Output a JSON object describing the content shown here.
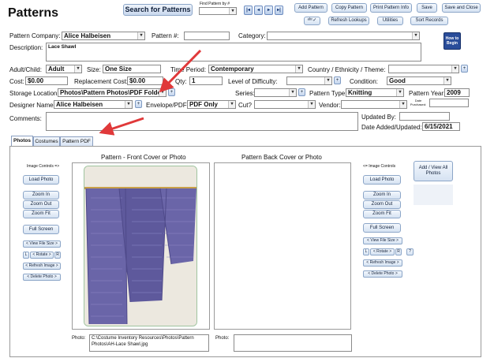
{
  "window": {
    "title": "Patterns"
  },
  "toolbar": {
    "search_label": "Search for Patterns",
    "find_label": "Find Pattern by #",
    "add_label": "Add Pattern",
    "copy_label": "Copy Pattern",
    "print_label": "Print Pattern Info",
    "save_label": "Save",
    "save_close_label": "Save and Close",
    "refresh_lookups_label": "Refresh Lookups",
    "utilities_label": "Utilities",
    "sort_records_label": "Sort Records",
    "howto_label": "How to Begin"
  },
  "form": {
    "pattern_company_label": "Pattern Company:",
    "pattern_company_value": "Alice Halbeisen",
    "pattern_num_label": "Pattern #:",
    "pattern_num_value": "",
    "category_label": "Category:",
    "category_value": "",
    "description_label": "Description:",
    "description_value": "Lace Shawl",
    "adult_child_label": "Adult/Child:",
    "adult_child_value": "Adult",
    "size_label": "Size:",
    "size_value": "One Size",
    "time_period_label": "Time Period:",
    "time_period_value": "Contemporary",
    "country_label": "Country / Ethnicity / Theme:",
    "country_value": "",
    "cost_label": "Cost:",
    "cost_value": "$0.00",
    "replacement_cost_label": "Replacement Cost:",
    "replacement_cost_value": "$0.00",
    "qty_label": "Qty:",
    "qty_value": "1",
    "difficulty_label": "Level of Difficulty:",
    "difficulty_value": "",
    "condition_label": "Condition:",
    "condition_value": "Good",
    "storage_label": "Storage Location:",
    "storage_value": "Photos\\Pattern Photos\\PDF Folder",
    "series_label": "Series:",
    "series_value": "",
    "pattern_type_label": "Pattern Type:",
    "pattern_type_value": "Knitting",
    "pattern_year_label": "Pattern Year:",
    "pattern_year_value": "2009",
    "designer_label": "Designer Name:",
    "designer_value": "Alice Halbeisen",
    "envelope_label": "Envelope/PDF:",
    "envelope_value": "PDF Only",
    "cut_label": "Cut?",
    "cut_value": "",
    "vendor_label": "Vendor:",
    "vendor_value": "",
    "date_purchased_label": "Date Purchased:",
    "date_purchased_value": "",
    "comments_label": "Comments:",
    "comments_value": "",
    "updated_by_label": "Updated By:",
    "updated_by_value": "",
    "date_added_label": "Date Added/Updated:",
    "date_added_value": "6/15/2021"
  },
  "tabs": [
    {
      "label": "Photos"
    },
    {
      "label": "Costumes"
    },
    {
      "label": "Pattern PDF"
    }
  ],
  "photos": {
    "front_title": "Pattern - Front Cover or Photo",
    "back_title": "Pattern Back Cover or Photo",
    "left_controls_label": "Image Controls =>",
    "right_controls_label": "<= Image Controls",
    "load_photo": "Load Photo",
    "zoom_in": "Zoom In",
    "zoom_out": "Zoom Out",
    "zoom_fit": "Zoom Fit",
    "full_screen": "Full Screen",
    "view_file_size": "< View File Size >",
    "rotate_l": "L",
    "rotate": "< Rotate >",
    "rotate_r": "R",
    "refresh_image": "< Refresh Image >",
    "delete_photo": "< Delete Photo >",
    "help": "?",
    "add_view_all": "Add / View All Photos",
    "photo_label": "Photo:",
    "front_photo_path": "C:\\Costume Inventory Resources\\Photos\\Pattern Photos\\AH-Lace Shawl.jpg",
    "back_photo_path": ""
  },
  "colors": {
    "shawl": "#6a65a8",
    "shawl_dark": "#4f4a8a",
    "arrow": "#e0393a",
    "book": "#2a4d9a"
  }
}
